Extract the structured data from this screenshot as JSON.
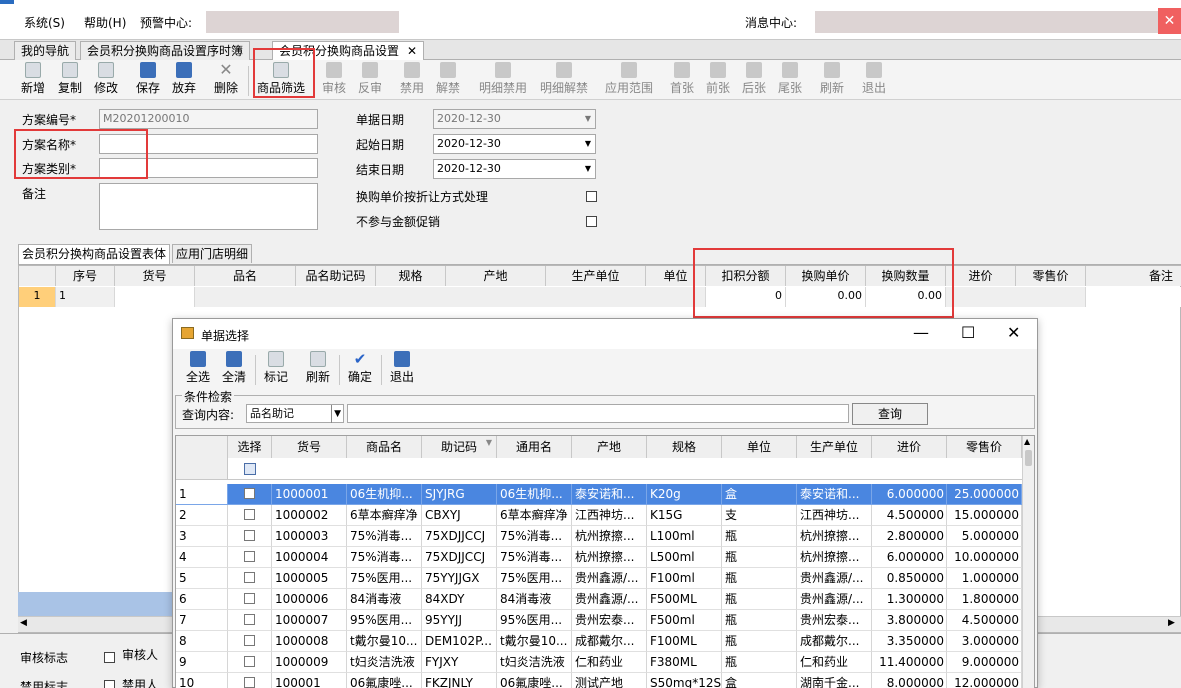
{
  "menubar": {
    "system": "系统(S)",
    "help": "帮助(H)",
    "alert_center": "预警中心:",
    "message_center": "消息中心:"
  },
  "tabs": [
    {
      "label": "我的导航"
    },
    {
      "label": "会员积分换购商品设置序时簿"
    },
    {
      "label": "会员积分换购商品设置"
    }
  ],
  "toolbar": [
    {
      "label": "新增"
    },
    {
      "label": "复制"
    },
    {
      "label": "修改"
    },
    {
      "label": "保存"
    },
    {
      "label": "放弃"
    },
    {
      "label": "删除"
    },
    {
      "label": "商品筛选"
    },
    {
      "label": "审核"
    },
    {
      "label": "反审"
    },
    {
      "label": "禁用"
    },
    {
      "label": "解禁"
    },
    {
      "label": "明细禁用"
    },
    {
      "label": "明细解禁"
    },
    {
      "label": "应用范围"
    },
    {
      "label": "首张"
    },
    {
      "label": "前张"
    },
    {
      "label": "后张"
    },
    {
      "label": "尾张"
    },
    {
      "label": "刷新"
    },
    {
      "label": "退出"
    }
  ],
  "form": {
    "scheme_no_label": "方案编号*",
    "scheme_no_value": "M20201200010",
    "scheme_name_label": "方案名称*",
    "scheme_type_label": "方案类别*",
    "remark_label": "备注",
    "doc_date_label": "单据日期",
    "doc_date_value": "2020-12-30",
    "start_date_label": "起始日期",
    "start_date_value": "2020-12-30",
    "end_date_label": "结束日期",
    "end_date_value": "2020-12-30",
    "discount_label": "换购单价按折让方式处理",
    "no_promo_label": "不参与金额促销"
  },
  "lower_tabs": [
    {
      "label": "会员积分换构商品设置表体"
    },
    {
      "label": "应用门店明细"
    }
  ],
  "grid": {
    "headers": [
      "序号",
      "货号",
      "品名",
      "品名助记码",
      "规格",
      "产地",
      "生产单位",
      "单位",
      "扣积分额",
      "换购单价",
      "换购数量",
      "进价",
      "零售价",
      "备注"
    ],
    "row": {
      "rownum": "1",
      "seq": "1",
      "points": "0",
      "price": "0.00",
      "qty": "0.00"
    }
  },
  "bottom": {
    "audit_flag": "审核标志",
    "auditor": "审核人",
    "disable_flag": "禁用标志",
    "disabler": "禁用人"
  },
  "dialog": {
    "title": "单据选择",
    "toolbar": [
      {
        "label": "全选"
      },
      {
        "label": "全清"
      },
      {
        "label": "标记"
      },
      {
        "label": "刷新"
      },
      {
        "label": "确定"
      },
      {
        "label": "退出"
      }
    ],
    "cond_title": "条件检索",
    "query_label": "查询内容:",
    "query_field": "品名助记",
    "query_button": "查询",
    "headers": [
      "选择",
      "货号",
      "商品名",
      "助记码",
      "通用名",
      "产地",
      "规格",
      "单位",
      "生产单位",
      "进价",
      "零售价"
    ],
    "rows": [
      [
        "1",
        "1000001",
        "06生机抑...",
        "SJYJRG",
        "06生机抑...",
        "泰安诺和...",
        "K20g",
        "盒",
        "泰安诺和...",
        "6.000000",
        "25.000000"
      ],
      [
        "2",
        "1000002",
        "6草本癣痒净",
        "CBXYJ",
        "6草本癣痒净",
        "江西神坊...",
        "K15G",
        "支",
        "江西神坊...",
        "4.500000",
        "15.000000"
      ],
      [
        "3",
        "1000003",
        "75%消毒...",
        "75XDJJCCJ",
        "75%消毒...",
        "杭州撩擦...",
        "L100ml",
        "瓶",
        "杭州撩擦...",
        "2.800000",
        "5.000000"
      ],
      [
        "4",
        "1000004",
        "75%消毒...",
        "75XDJJCCJ",
        "75%消毒...",
        "杭州撩擦...",
        "L500ml",
        "瓶",
        "杭州撩擦...",
        "6.000000",
        "10.000000"
      ],
      [
        "5",
        "1000005",
        "75%医用...",
        "75YYJJGX",
        "75%医用...",
        "贵州鑫源/...",
        "F100ml",
        "瓶",
        "贵州鑫源/...",
        "0.850000",
        "1.000000"
      ],
      [
        "6",
        "1000006",
        "84消毒液",
        "84XDY",
        "84消毒液",
        "贵州鑫源/...",
        "F500ML",
        "瓶",
        "贵州鑫源/...",
        "1.300000",
        "1.800000"
      ],
      [
        "7",
        "1000007",
        "95%医用...",
        "95YYJJ",
        "95%医用...",
        "贵州宏泰...",
        "F500ml",
        "瓶",
        "贵州宏泰...",
        "3.800000",
        "4.500000"
      ],
      [
        "8",
        "1000008",
        "t戴尔曼10...",
        "DEM102P...",
        "t戴尔曼10...",
        "成都戴尔...",
        "F100ML",
        "瓶",
        "成都戴尔...",
        "3.350000",
        "3.000000"
      ],
      [
        "9",
        "1000009",
        "t妇炎洁洗液",
        "FYJXY",
        "t妇炎洁洗液",
        "仁和药业",
        "F380ML",
        "瓶",
        "仁和药业",
        "11.400000",
        "9.000000"
      ],
      [
        "10",
        "100001",
        "06氟康唑...",
        "FKZJNLY",
        "06氟康唑...",
        "测试产地",
        "S50mg*12S",
        "盒",
        "湖南千金...",
        "8.000000",
        "12.000000"
      ]
    ]
  }
}
